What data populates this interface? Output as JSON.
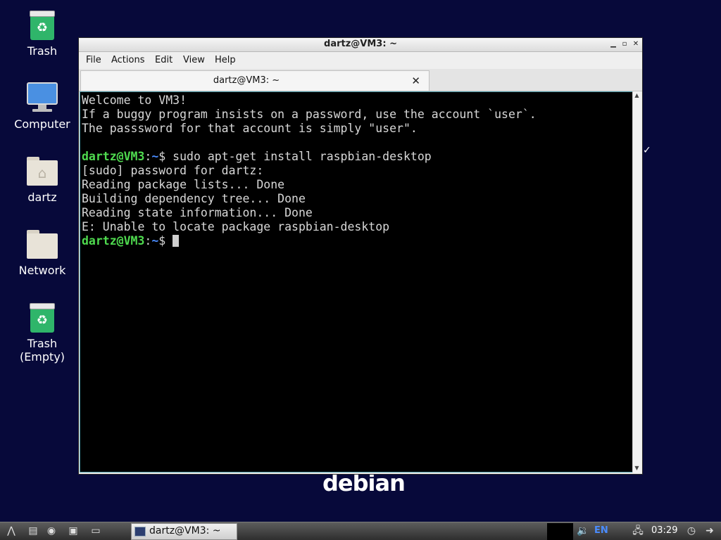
{
  "desktop": {
    "icons": [
      {
        "label": "Trash",
        "icon": "trash-icon"
      },
      {
        "label": "Computer",
        "icon": "computer-icon"
      },
      {
        "label": "dartz",
        "icon": "home-folder-icon"
      },
      {
        "label": "Network",
        "icon": "network-folder-icon"
      },
      {
        "label": "Trash\n(Empty)",
        "icon": "trash-empty-icon"
      }
    ],
    "logo_text": "debian"
  },
  "window": {
    "title": "dartz@VM3: ~",
    "controls": {
      "minimize": "minimize-icon",
      "maximize": "maximize-icon",
      "close": "close-icon"
    },
    "menu": [
      "File",
      "Actions",
      "Edit",
      "View",
      "Help"
    ],
    "tab": {
      "title": "dartz@VM3: ~",
      "close_icon": "close-tab-icon"
    },
    "terminal": {
      "prompt_user": "dartz@VM3",
      "prompt_path": "~",
      "lines": [
        "Welcome to VM3!",
        "If a buggy program insists on a password, use the account `user`.",
        "The passsword for that account is simply \"user\".",
        "",
        "$ sudo apt-get install raspbian-desktop",
        "[sudo] password for dartz:",
        "Reading package lists... Done",
        "Building dependency tree... Done",
        "Reading state information... Done",
        "E: Unable to locate package raspbian-desktop",
        "$ "
      ]
    }
  },
  "taskbar": {
    "launchers": [
      "start-menu-icon",
      "file-manager-icon",
      "web-browser-icon",
      "show-desktop-icon",
      "terminal-launcher-icon"
    ],
    "task": {
      "label": "dartz@VM3: ~",
      "icon": "terminal-window-icon"
    },
    "tray": {
      "volume_icon": "volume-icon",
      "language": "EN",
      "network_icon": "network-icon",
      "clock": "03:29",
      "notification_icon": "clock-applet-icon",
      "logout_icon": "logout-icon"
    }
  }
}
